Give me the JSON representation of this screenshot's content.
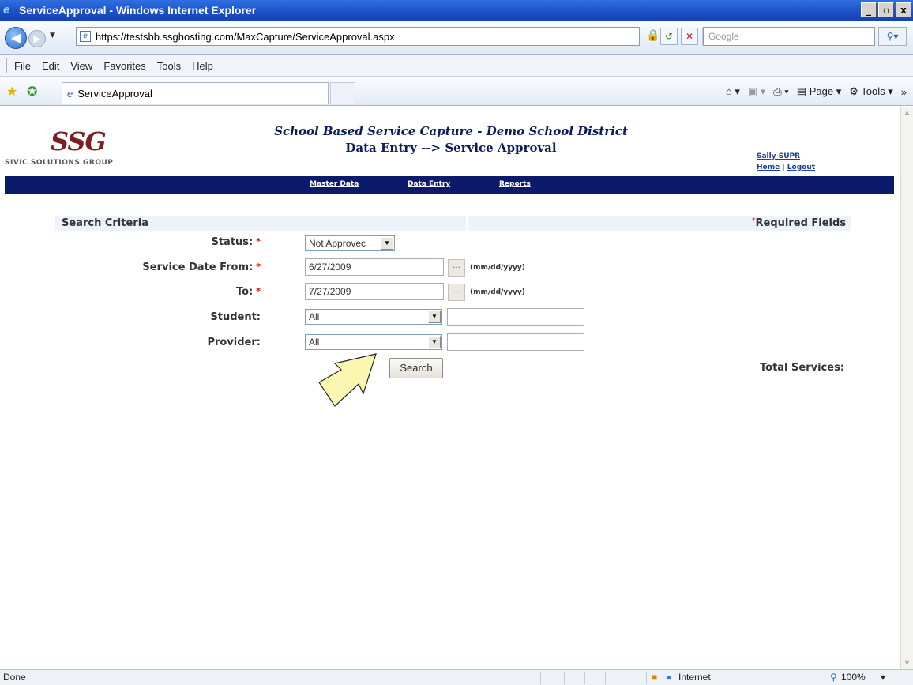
{
  "window": {
    "title": "ServiceApproval - Windows Internet Explorer",
    "min": "_",
    "max": "▫",
    "close": "x"
  },
  "browser": {
    "url": "https://testsbb.ssghosting.com/MaxCapture/ServiceApproval.aspx",
    "search_placeholder": "Google",
    "menu": [
      "File",
      "Edit",
      "View",
      "Favorites",
      "Tools",
      "Help"
    ],
    "tab_title": "ServiceApproval",
    "page_label": "Page",
    "tools_label": "Tools"
  },
  "status": {
    "left": "Done",
    "zone": "Internet",
    "zoom": "100%"
  },
  "page": {
    "logo_mark": "SSG",
    "logo_name": "SIVIC SOLUTIONS GROUP",
    "title_line1": "School Based Service Capture - Demo School District",
    "title_line2": "Data Entry --> Service Approval",
    "user": "Sally SUPR",
    "home": "Home",
    "separator": "|",
    "logout": "Logout",
    "nav": {
      "master_data": "Master Data",
      "data_entry": "Data Entry",
      "reports": "Reports"
    }
  },
  "form": {
    "section_title": "Search Criteria",
    "required_star": "*",
    "required_label": "Required Fields",
    "status_label": "Status:",
    "status_value": "Not Approvec",
    "date_from_label": "Service Date From:",
    "date_from_value": "6/27/2009",
    "date_to_label": "To:",
    "date_to_value": "7/27/2009",
    "date_hint": "(mm/dd/yyyy)",
    "cal_btn": "...",
    "student_label": "Student:",
    "student_value": "All",
    "provider_label": "Provider:",
    "provider_value": "All",
    "search_button": "Search",
    "total_label": "Total Services:"
  }
}
